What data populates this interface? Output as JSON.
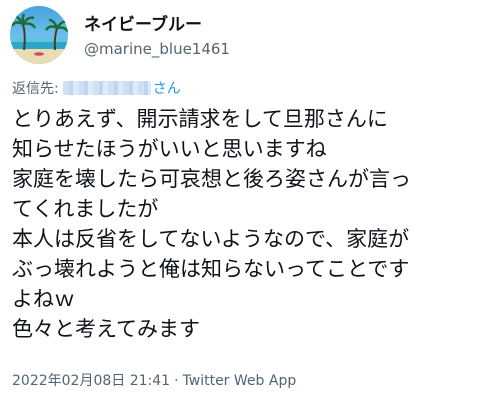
{
  "author": {
    "display_name": "ネイビーブルー",
    "handle": "@marine_blue1461"
  },
  "reply": {
    "prefix": "返信先:",
    "suffix": "さん"
  },
  "tweet": {
    "lines": [
      "とりあえず、開示請求をして旦那さんに",
      "知らせたほうがいいと思いますね",
      "家庭を壊したら可哀想と後ろ姿さんが言っ",
      "てくれましたが",
      "本人は反省をしてないようなので、家庭が",
      "ぶっ壊れようと俺は知らないってことです",
      "よねｗ",
      "色々と考えてみます"
    ]
  },
  "meta": {
    "timestamp": "2022年02月08日 21:41",
    "separator": "·",
    "client": "Twitter Web App"
  },
  "colors": {
    "text": "#0f1419",
    "secondary": "#536471",
    "accent": "#1d9bf0"
  },
  "icons": {
    "avatar": "beach-palm-tree-avatar"
  }
}
